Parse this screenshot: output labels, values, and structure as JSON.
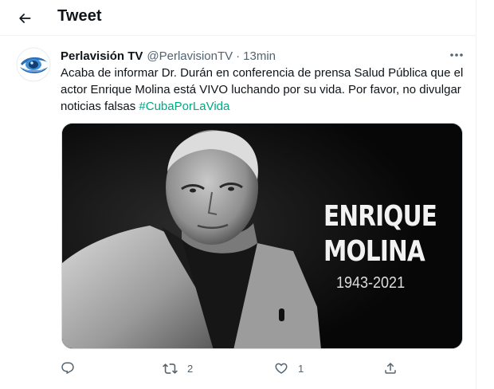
{
  "header": {
    "title": "Tweet",
    "back_icon": "arrow-left-icon"
  },
  "tweet": {
    "display_name": "Perlavisión TV",
    "handle": "@PerlavisionTV",
    "separator": "·",
    "time": "13min",
    "text": "Acaba de informar Dr. Durán en conferencia de prensa Salud Pública que el actor Enrique Molina está VIVO luchando por su vida. Por favor, no divulgar noticias falsas ",
    "hashtag": "#CubaPorLaVida",
    "hashtag_color": "#00a884",
    "media": {
      "name_line1": "ENRIQUE",
      "name_line2": "MOLINA",
      "years": "1943-2021"
    }
  },
  "actions": {
    "reply_icon": "reply-bubble-icon",
    "retweet_icon": "retweet-icon",
    "retweet_count": "2",
    "like_icon": "heart-icon",
    "like_count": "1",
    "share_icon": "share-icon"
  },
  "colors": {
    "text": "#0f1419",
    "secondary": "#536471",
    "border": "#eff3f4"
  }
}
